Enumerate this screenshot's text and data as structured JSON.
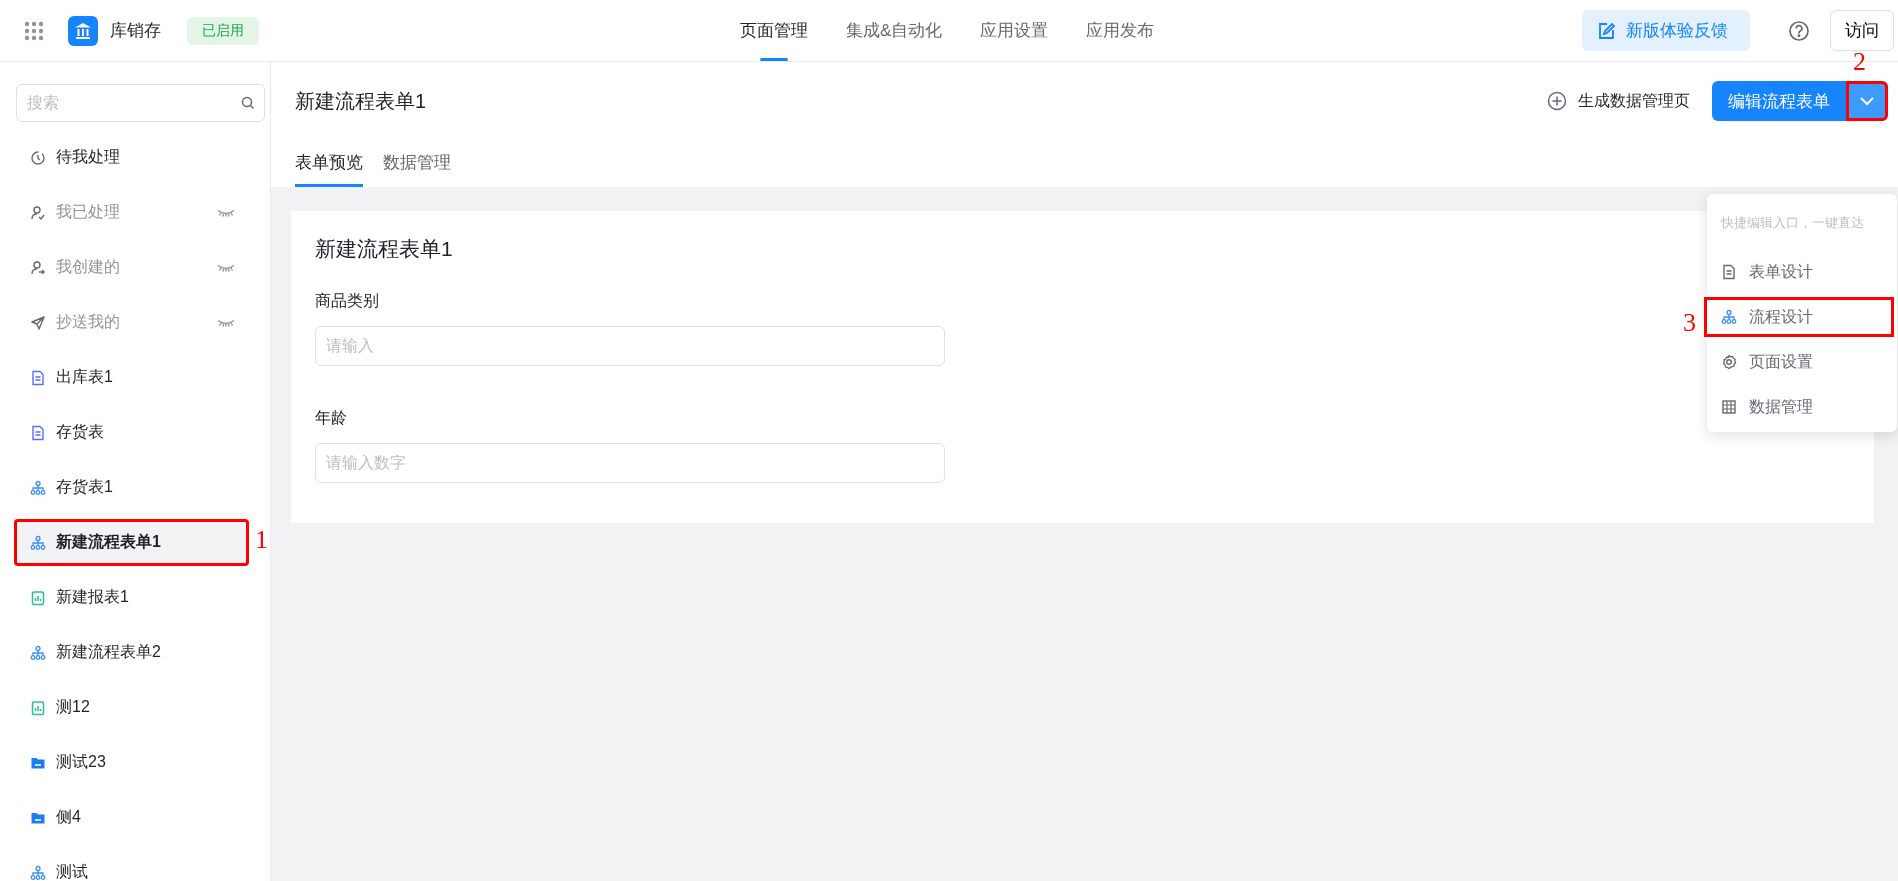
{
  "topbar": {
    "app_name": "库销存",
    "status_badge": "已启用",
    "nav": [
      {
        "label": "页面管理",
        "selected": true
      },
      {
        "label": "集成&自动化",
        "selected": false
      },
      {
        "label": "应用设置",
        "selected": false
      },
      {
        "label": "应用发布",
        "selected": false
      }
    ],
    "feedback_button": "新版体验反馈",
    "visit_button": "访问"
  },
  "sidebar": {
    "search": {
      "placeholder": "搜索"
    },
    "items": [
      {
        "label": "待我处理",
        "kind": "clock",
        "hidden": false,
        "selected": false
      },
      {
        "label": "我已处理",
        "kind": "user-check",
        "hidden": true,
        "selected": false
      },
      {
        "label": "我创建的",
        "kind": "user-out",
        "hidden": true,
        "selected": false
      },
      {
        "label": "抄送我的",
        "kind": "send",
        "hidden": true,
        "selected": false
      },
      {
        "label": "出库表1",
        "kind": "form",
        "hidden": false,
        "selected": false
      },
      {
        "label": "存货表",
        "kind": "form",
        "hidden": false,
        "selected": false
      },
      {
        "label": "存货表1",
        "kind": "flow",
        "hidden": false,
        "selected": false
      },
      {
        "label": "新建流程表单1",
        "kind": "flow",
        "hidden": false,
        "selected": true,
        "callout": "1"
      },
      {
        "label": "新建报表1",
        "kind": "report",
        "hidden": false,
        "selected": false
      },
      {
        "label": "新建流程表单2",
        "kind": "flow",
        "hidden": false,
        "selected": false
      },
      {
        "label": "测12",
        "kind": "report",
        "hidden": false,
        "selected": false
      },
      {
        "label": "测试23",
        "kind": "folder",
        "hidden": false,
        "selected": false
      },
      {
        "label": "侧4",
        "kind": "folder",
        "hidden": false,
        "selected": false
      },
      {
        "label": "测试",
        "kind": "flow",
        "hidden": false,
        "selected": false
      }
    ]
  },
  "page": {
    "title": "新建流程表单1",
    "generate_button": "生成数据管理页",
    "edit_button": "编辑流程表单",
    "toggle_callout": "2",
    "tabs": [
      {
        "label": "表单预览",
        "selected": true
      },
      {
        "label": "数据管理",
        "selected": false
      }
    ],
    "form": {
      "title": "新建流程表单1",
      "fields": [
        {
          "label": "商品类别",
          "placeholder": "请输入"
        },
        {
          "label": "年龄",
          "placeholder": "请输入数字"
        }
      ]
    }
  },
  "dropdown": {
    "hint": "快捷编辑入口，一键直达",
    "items": [
      {
        "label": "表单设计",
        "kind": "doc"
      },
      {
        "label": "流程设计",
        "kind": "flow",
        "callout": "3"
      },
      {
        "label": "页面设置",
        "kind": "gear"
      },
      {
        "label": "数据管理",
        "kind": "table"
      }
    ]
  }
}
